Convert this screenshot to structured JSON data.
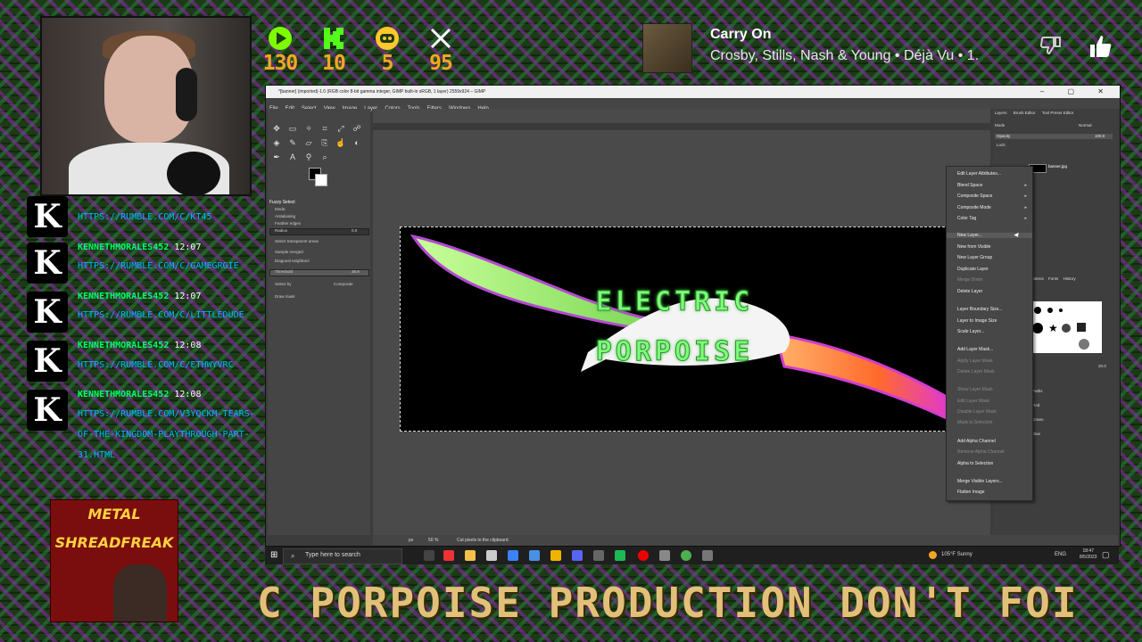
{
  "stats": [
    {
      "icon": "play-icon",
      "value": "130",
      "color": "#7CFC00"
    },
    {
      "icon": "kick-k-icon",
      "value": "10",
      "color": "#53FC18"
    },
    {
      "icon": "trovo-icon",
      "value": "5",
      "color": "#FFC72C"
    },
    {
      "icon": "x-icon",
      "value": "95",
      "color": "#FFFFFF"
    }
  ],
  "now_playing": {
    "title": "Carry On",
    "artist": "Crosby, Stills, Nash & Young • Déjà Vu • 1."
  },
  "chat": [
    {
      "avatar": "K",
      "name": "",
      "time": "",
      "message": "HTTPS://RUMBLE.COM/C/KT45"
    },
    {
      "avatar": "K",
      "name": "KENNETHMORALES452",
      "time": "12:07",
      "message": "HTTPS://RUMBLE.COM/C/GAMEGRGIE"
    },
    {
      "avatar": "K",
      "name": "KENNETHMORALES452",
      "time": "12:07",
      "message": "HTTPS://RUMBLE.COM/C/LITTLEDUDE"
    },
    {
      "avatar": "K",
      "name": "KENNETHMORALES452",
      "time": "12:08",
      "message": "HTTPS://RUMBLE.COM/C/ETHWYVRC"
    },
    {
      "avatar": "K",
      "name": "KENNETHMORALES452",
      "time": "12:08",
      "message": "HTTPS://RUMBLE.COM/V3YQCKM-TEARS-OF-THE-KINGDOM-PLAYTHROUGH-PART-31.HTML"
    }
  ],
  "banner": {
    "line1": "METAL",
    "line2": "SHREADFREAK"
  },
  "ticker": "C PORPOISE PRODUCTION  DON'T FOI",
  "gimp": {
    "title": "*[banner] (imported)-1.0 (RGB color 8-bit gamma integer, GIMP built-in sRGB, 1 layer) 2559x924 – GIMP",
    "menu": [
      "File",
      "Edit",
      "Select",
      "View",
      "Image",
      "Layer",
      "Colors",
      "Tools",
      "Filters",
      "Windows",
      "Help"
    ],
    "tool_options": {
      "title": "Fuzzy Select",
      "mode": "Mode:",
      "antialiasing": "Antialiasing",
      "feather": "Feather edges",
      "radius_label": "Radius",
      "radius_value": "0.0",
      "select_transparent": "Select transparent areas",
      "sample_merged": "Sample merged",
      "diagonal": "Diagonal neighbors",
      "threshold_label": "Threshold",
      "threshold_value": "36.9",
      "select_by": "Select by",
      "select_by_value": "Composite",
      "draw_mask": "Draw mask"
    },
    "image_text": {
      "line1": "ELECTRIC",
      "line2": "PORPOISE"
    },
    "layers_panel": {
      "tabs": [
        "Layers",
        "Brush Editor",
        "Tool Preset Editor"
      ],
      "mode_label": "Mode",
      "mode_value": "Normal",
      "opacity_label": "Opacity",
      "opacity_value": "100.0",
      "lock_label": "Lock:",
      "layer_name": "banner.jpg",
      "brush_tabs": [
        "Patterns",
        "Fonts",
        "History"
      ],
      "paths_tab": "Paths",
      "spacing_value": "20.0",
      "channels": [
        "Red",
        "Green",
        "Blue"
      ]
    },
    "status_text": "Cut pixels to the clipboard.",
    "zoom": "50 %",
    "unit": "px",
    "context_menu": [
      {
        "label": "Edit Layer Attributes...",
        "enabled": true,
        "submenu": false
      },
      {
        "label": "Blend Space",
        "enabled": true,
        "submenu": true
      },
      {
        "label": "Composite Space",
        "enabled": true,
        "submenu": true
      },
      {
        "label": "Composite Mode",
        "enabled": true,
        "submenu": true
      },
      {
        "label": "Color Tag",
        "enabled": true,
        "submenu": true
      },
      {
        "label": "New Layer...",
        "enabled": true,
        "submenu": false,
        "highlighted": true
      },
      {
        "label": "New from Visible",
        "enabled": true,
        "submenu": false
      },
      {
        "label": "New Layer Group",
        "enabled": true,
        "submenu": false
      },
      {
        "label": "Duplicate Layer",
        "enabled": true,
        "submenu": false
      },
      {
        "label": "Merge Down",
        "enabled": false,
        "submenu": false
      },
      {
        "label": "Delete Layer",
        "enabled": true,
        "submenu": false
      },
      {
        "label": "Layer Boundary Size...",
        "enabled": true,
        "submenu": false
      },
      {
        "label": "Layer to Image Size",
        "enabled": true,
        "submenu": false
      },
      {
        "label": "Scale Layer...",
        "enabled": true,
        "submenu": false
      },
      {
        "label": "Add Layer Mask...",
        "enabled": true,
        "submenu": false
      },
      {
        "label": "Apply Layer Mask",
        "enabled": false,
        "submenu": false
      },
      {
        "label": "Delete Layer Mask",
        "enabled": false,
        "submenu": false
      },
      {
        "label": "Show Layer Mask",
        "enabled": false,
        "submenu": false
      },
      {
        "label": "Edit Layer Mask",
        "enabled": false,
        "submenu": false
      },
      {
        "label": "Disable Layer Mask",
        "enabled": false,
        "submenu": false
      },
      {
        "label": "Mask to Selection",
        "enabled": false,
        "submenu": false
      },
      {
        "label": "Add Alpha Channel",
        "enabled": true,
        "submenu": false
      },
      {
        "label": "Remove Alpha Channel",
        "enabled": false,
        "submenu": false
      },
      {
        "label": "Alpha to Selection",
        "enabled": true,
        "submenu": false
      },
      {
        "label": "Merge Visible Layers...",
        "enabled": true,
        "submenu": false
      },
      {
        "label": "Flatten Image",
        "enabled": true,
        "submenu": false
      }
    ]
  },
  "taskbar": {
    "search_placeholder": "Type here to search",
    "weather": "105°F  Sunny",
    "lang": "ENG",
    "time": "18:47",
    "date": "8/5/2023"
  }
}
